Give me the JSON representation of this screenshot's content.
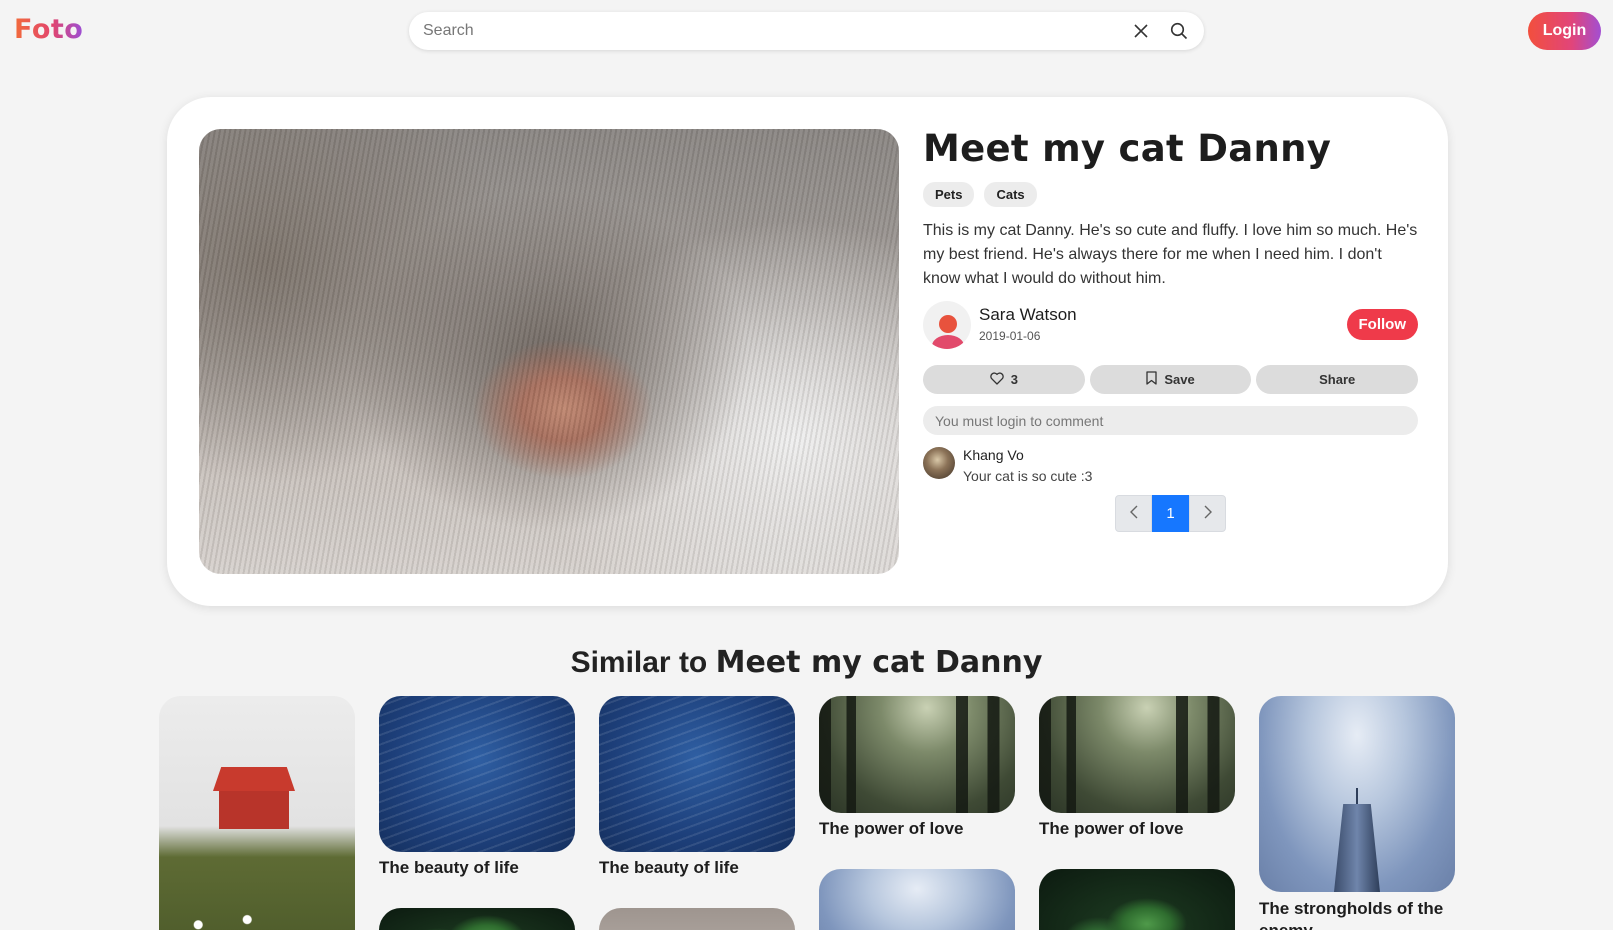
{
  "header": {
    "logo": "Foto",
    "search_placeholder": "Search",
    "login_label": "Login"
  },
  "post": {
    "title": "Meet my cat Danny",
    "tags": [
      "Pets",
      "Cats"
    ],
    "description": "This is my cat Danny. He's so cute and fluffy. I love him so much. He's my best friend. He's always there for me when I need him. I don't know what I would do without him.",
    "author": {
      "name": "Sara Watson",
      "date": "2019-01-06"
    },
    "follow_label": "Follow",
    "likes": "3",
    "save_label": "Save",
    "share_label": "Share",
    "comment_placeholder": "You must login to comment",
    "comments": [
      {
        "name": "Khang Vo",
        "text": "Your cat is so cute :3"
      }
    ],
    "pagination": {
      "current": "1"
    }
  },
  "similar": {
    "heading_prefix": "Similar to",
    "heading_title": "Meet my cat Danny",
    "items": [
      {
        "label": ""
      },
      {
        "label": "The beauty of life"
      },
      {
        "label": "The beauty of life"
      },
      {
        "label": "The power of love"
      },
      {
        "label": "The power of love"
      },
      {
        "label": "The strongholds of the enemy"
      }
    ]
  },
  "colors": {
    "brand_gradient_start": "#f26b3a",
    "brand_gradient_end": "#9b4fd6",
    "follow": "#ef3a4a",
    "pagination_active": "#1677ff"
  },
  "icons": [
    "close-icon",
    "search-icon",
    "heart-icon",
    "bookmark-icon",
    "chevron-left-icon",
    "chevron-right-icon"
  ]
}
